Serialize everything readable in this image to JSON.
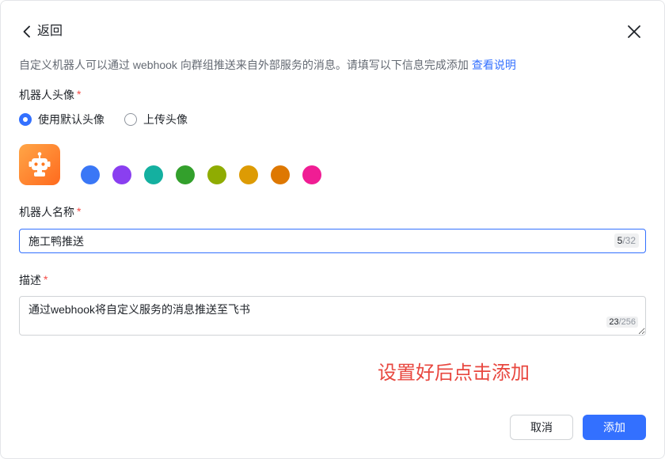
{
  "header": {
    "back_label": "返回",
    "back_icon": "chevron-left-icon",
    "close_icon": "close-icon"
  },
  "description": {
    "text": "自定义机器人可以通过 webhook 向群组推送来自外部服务的消息。请填写以下信息完成添加",
    "link_label": "查看说明"
  },
  "avatar": {
    "label": "机器人头像",
    "required_mark": "*",
    "options": [
      {
        "label": "使用默认头像",
        "selected": true
      },
      {
        "label": "上传头像",
        "selected": false
      }
    ],
    "current_icon": "robot-icon",
    "colors": [
      "#3a77f6",
      "#8a3ff0",
      "#14b0a0",
      "#33a02c",
      "#8fac02",
      "#dd9b04",
      "#de7802",
      "#f01d94"
    ]
  },
  "name_field": {
    "label": "机器人名称",
    "required_mark": "*",
    "value": "施工鸭推送",
    "char_count": "5",
    "char_limit": "/32"
  },
  "description_field": {
    "label": "描述",
    "required_mark": "*",
    "value": "通过webhook将自定义服务的消息推送至飞书",
    "char_count": "23",
    "char_limit": "/256"
  },
  "annotation": {
    "text": "设置好后点击添加",
    "color": "#e8473f"
  },
  "footer": {
    "cancel_label": "取消",
    "add_label": "添加"
  },
  "theme": {
    "accent": "#3370ff",
    "required": "#f54a45"
  }
}
